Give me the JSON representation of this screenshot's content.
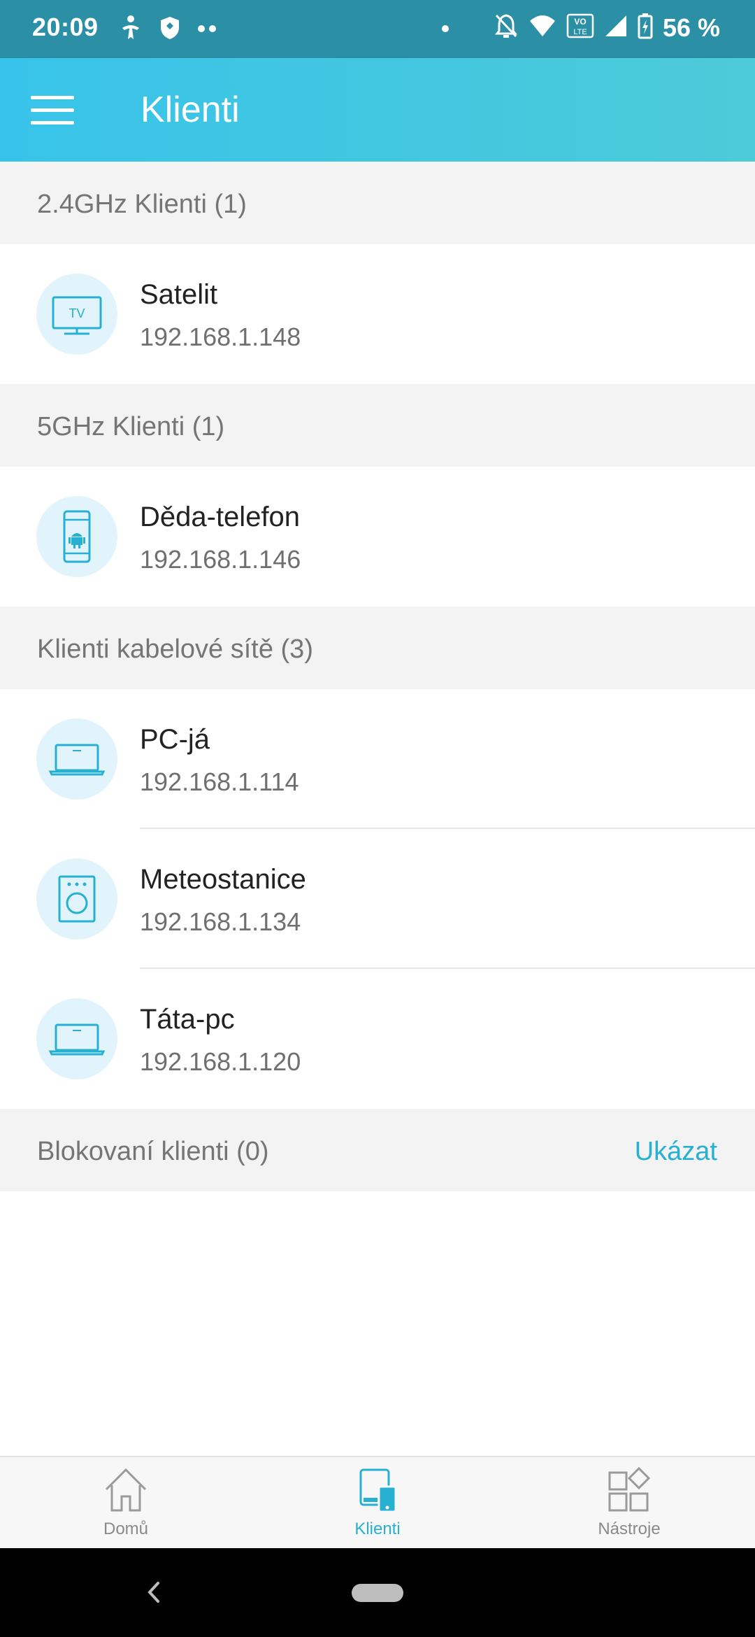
{
  "status_bar": {
    "time": "20:09",
    "battery": "56 %",
    "icons": [
      "accessibility-icon",
      "shield-icon",
      "more-dots-icon",
      "mute-icon",
      "wifi-icon",
      "volte-icon",
      "signal-icon",
      "battery-charging-icon"
    ]
  },
  "app_bar": {
    "title": "Klienti",
    "menu_icon": "hamburger-menu-icon"
  },
  "sections": {
    "band24": {
      "title": "2.4GHz Klienti (1)",
      "clients": [
        {
          "name": "Satelit",
          "ip": "192.168.1.148",
          "icon": "tv-icon",
          "icon_text": "TV"
        }
      ]
    },
    "band5": {
      "title": "5GHz Klienti (1)",
      "clients": [
        {
          "name": "Děda-telefon",
          "ip": "192.168.1.146",
          "icon": "android-phone-icon"
        }
      ]
    },
    "wired": {
      "title": "Klienti kabelové sítě (3)",
      "clients": [
        {
          "name": "PC-já",
          "ip": "192.168.1.114",
          "icon": "laptop-icon"
        },
        {
          "name": "Meteostanice",
          "ip": "192.168.1.134",
          "icon": "appliance-icon"
        },
        {
          "name": "Táta-pc",
          "ip": "192.168.1.120",
          "icon": "laptop-icon"
        }
      ]
    },
    "blocked": {
      "title": "Blokovaní klienti (0)",
      "action": "Ukázat"
    }
  },
  "bottom_nav": {
    "items": [
      {
        "label": "Domů",
        "icon": "home-icon",
        "active": false
      },
      {
        "label": "Klienti",
        "icon": "devices-icon",
        "active": true
      },
      {
        "label": "Nástroje",
        "icon": "tools-grid-icon",
        "active": false
      }
    ]
  },
  "colors": {
    "status_bar": "#2b8fa6",
    "app_bar_start": "#38c3ea",
    "app_bar_end": "#4ccbd8",
    "accent": "#27b0d1",
    "avatar_bg": "#e1f4fb",
    "section_bg": "#f3f3f3"
  }
}
